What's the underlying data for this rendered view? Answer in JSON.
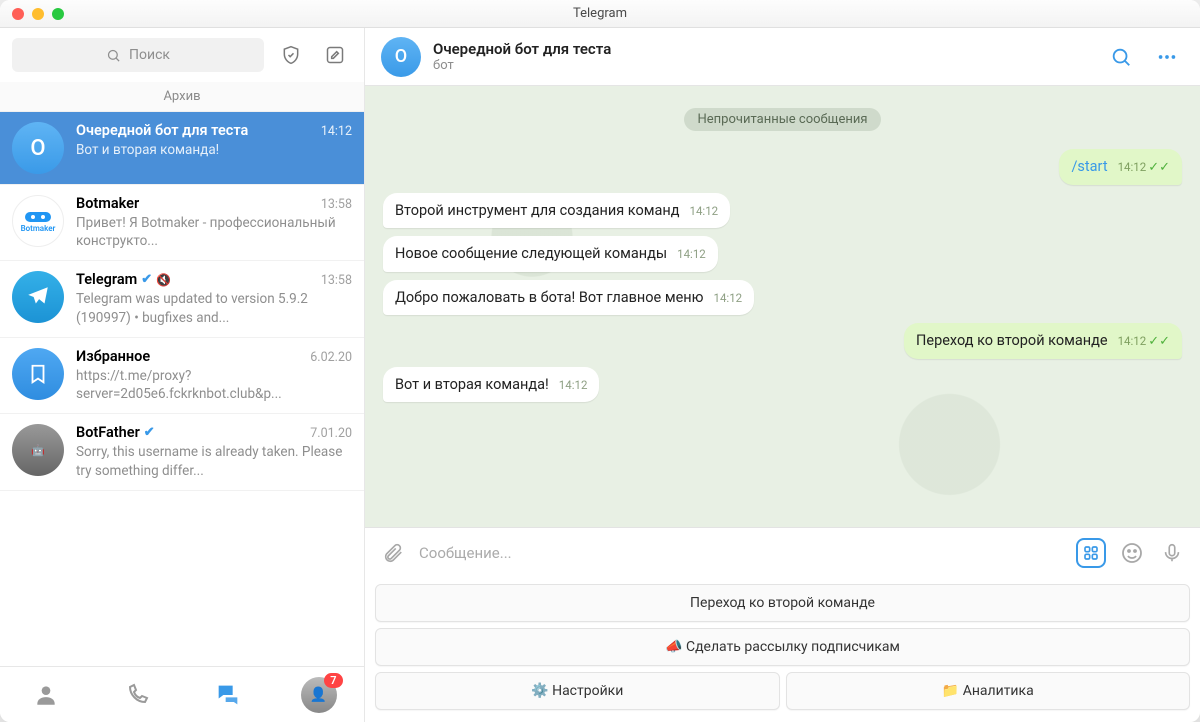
{
  "window": {
    "title": "Telegram"
  },
  "search": {
    "placeholder": "Поиск"
  },
  "archive_label": "Архив",
  "chats": [
    {
      "name": "Очередной бот для теста",
      "preview": "Вот и вторая команда!",
      "time": "14:12",
      "initial": "О"
    },
    {
      "name": "Botmaker",
      "preview": "Привет! Я Botmaker - профессиональный конструкто...",
      "time": "13:58"
    },
    {
      "name": "Telegram",
      "preview": "Telegram was updated to version 5.9.2 (190997)    •   bugfixes and...",
      "time": "13:58"
    },
    {
      "name": "Избранное",
      "preview": "https://t.me/proxy?server=2d05e6.fckrknbot.club&p...",
      "time": "6.02.20"
    },
    {
      "name": "BotFather",
      "preview": "Sorry, this username is already taken. Please try something differ...",
      "time": "7.01.20"
    }
  ],
  "header": {
    "name": "Очередной бот для теста",
    "subtitle": "бот",
    "initial": "О"
  },
  "divider": "Непрочитанные сообщения",
  "messages": [
    {
      "side": "out",
      "text": "/start",
      "time": "14:12",
      "cmd": true
    },
    {
      "side": "in",
      "text": "Второй инструмент для создания команд",
      "time": "14:12"
    },
    {
      "side": "in",
      "text": "Новое сообщение следующей команды",
      "time": "14:12"
    },
    {
      "side": "in",
      "text": "Добро пожаловать в бота! Вот главное меню",
      "time": "14:12"
    },
    {
      "side": "out",
      "text": "Переход ко второй команде",
      "time": "14:12"
    },
    {
      "side": "in",
      "text": "Вот и вторая команда!",
      "time": "14:12"
    }
  ],
  "compose": {
    "placeholder": "Сообщение..."
  },
  "keyboard": {
    "rows": [
      [
        "Переход ко второй команде"
      ],
      [
        "📣 Сделать рассылку подписчикам"
      ],
      [
        "⚙️ Настройки",
        "📁 Аналитика"
      ]
    ]
  },
  "tabs": {
    "badge": "7"
  }
}
